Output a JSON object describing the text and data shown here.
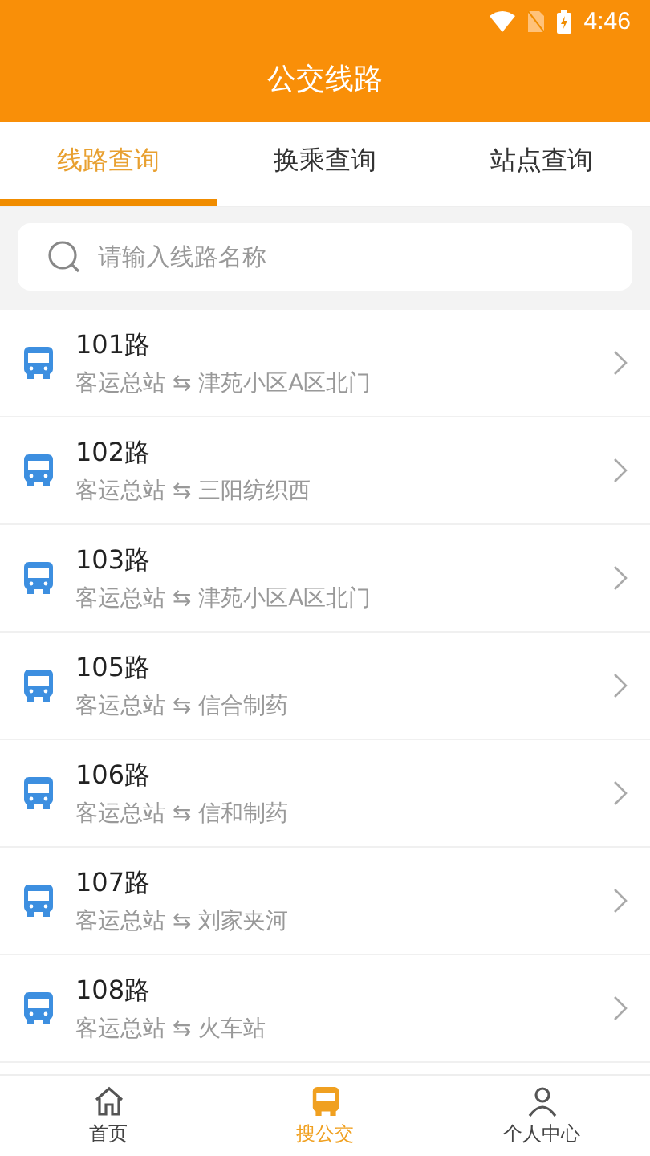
{
  "status_bar": {
    "time": "4:46"
  },
  "header": {
    "title": "公交线路"
  },
  "tabs": [
    {
      "label": "线路查询",
      "selected": true
    },
    {
      "label": "换乘查询",
      "selected": false
    },
    {
      "label": "站点查询",
      "selected": false
    }
  ],
  "search": {
    "placeholder": "请输入线路名称"
  },
  "routes": [
    {
      "name": "101路",
      "stops": "客运总站 ⇆ 津苑小区A区北门"
    },
    {
      "name": "102路",
      "stops": "客运总站 ⇆ 三阳纺织西"
    },
    {
      "name": "103路",
      "stops": "客运总站 ⇆ 津苑小区A区北门"
    },
    {
      "name": "105路",
      "stops": "客运总站 ⇆ 信合制药"
    },
    {
      "name": "106路",
      "stops": "客运总站 ⇆ 信和制药"
    },
    {
      "name": "107路",
      "stops": "客运总站 ⇆ 刘家夹河"
    },
    {
      "name": "108路",
      "stops": "客运总站 ⇆ 火车站"
    }
  ],
  "bottom_nav": [
    {
      "label": "首页",
      "kind": "home",
      "selected": false
    },
    {
      "label": "搜公交",
      "kind": "bus",
      "selected": true
    },
    {
      "label": "个人中心",
      "kind": "person",
      "selected": false
    }
  ]
}
